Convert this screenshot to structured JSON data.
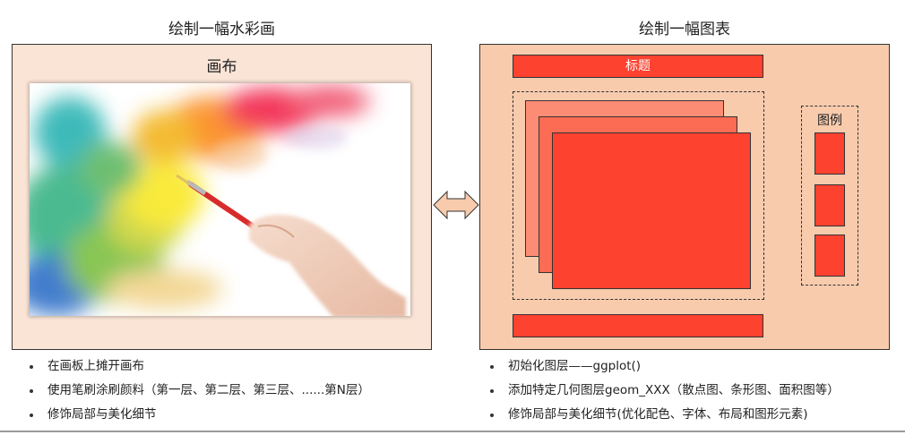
{
  "left": {
    "title": "绘制一幅水彩画",
    "canvas_label": "画布",
    "bullets": [
      "在画板上摊开画布",
      "使用笔刷涂刷颜料（第一层、第二层、第三层、......第N层）",
      "修饰局部与美化细节"
    ]
  },
  "right": {
    "title": "绘制一幅图表",
    "chart_title": "标题",
    "legend_label": "图例",
    "bullets": [
      "初始化图层——ggplot()",
      "添加特定几何图层geom_XXX（散点图、条形图、面积图等）",
      "修饰局部与美化细节(优化配色、字体、布局和图形元素)"
    ]
  },
  "colors": {
    "left_panel_bg": "#fae4d6",
    "right_panel_bg": "#f8cbad",
    "accent_red": "#fe4230",
    "layer_back": "#fc8c74",
    "layer_mid": "#fc6b54",
    "arrow_fill": "#f8cbad"
  },
  "icons": [
    "paintbrush-hand-illustration",
    "double-arrow-icon"
  ]
}
